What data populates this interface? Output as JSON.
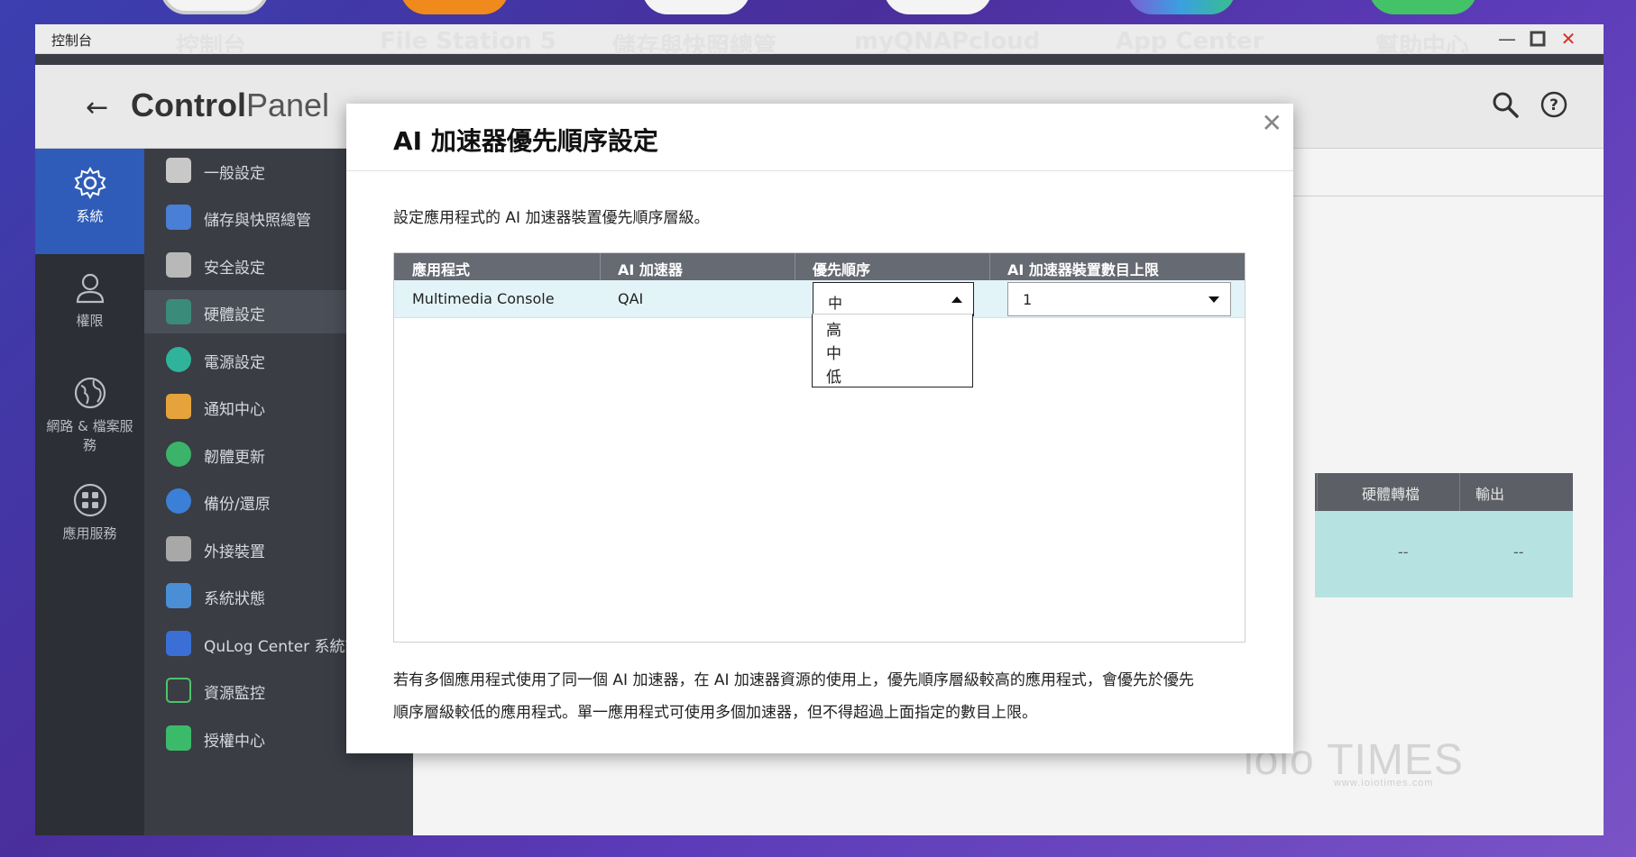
{
  "window": {
    "title": "控制台",
    "taskbar_ghost": [
      "控制台",
      "File Station 5",
      "儲存與快照總管",
      "myQNAPcloud",
      "App Center",
      "幫助中心"
    ]
  },
  "header": {
    "title_bold": "Control",
    "title_light": "Panel"
  },
  "categories": [
    {
      "label": "系統",
      "icon": "gear-icon",
      "active": true
    },
    {
      "label": "權限",
      "icon": "user-icon",
      "active": false
    },
    {
      "label": "網路 & 檔案服務",
      "icon": "globe-icon",
      "active": false
    },
    {
      "label": "應用服務",
      "icon": "apps-grid-icon",
      "active": false
    }
  ],
  "menu": [
    {
      "label": "一般設定",
      "icon": "general-settings-icon",
      "color": "#c8c8c8",
      "active": false
    },
    {
      "label": "儲存與快照總管",
      "icon": "storage-snapshot-icon",
      "color": "#4a7fd6",
      "active": false
    },
    {
      "label": "安全設定",
      "icon": "lock-icon",
      "color": "#b8b8b8",
      "active": false
    },
    {
      "label": "硬體設定",
      "icon": "hardware-chip-icon",
      "color": "#3b8b7a",
      "active": true
    },
    {
      "label": "電源設定",
      "icon": "power-bulb-icon",
      "color": "#2fb39a",
      "active": false
    },
    {
      "label": "通知中心",
      "icon": "notification-bell-icon",
      "color": "#e7a33b",
      "active": false
    },
    {
      "label": "韌體更新",
      "icon": "firmware-update-icon",
      "color": "#3bb36a",
      "active": false
    },
    {
      "label": "備份/還原",
      "icon": "backup-restore-icon",
      "color": "#3b7fd6",
      "active": false
    },
    {
      "label": "外接裝置",
      "icon": "external-device-icon",
      "color": "#a8a8a8",
      "active": false
    },
    {
      "label": "系統狀態",
      "icon": "system-status-icon",
      "color": "#4a8fd6",
      "active": false
    },
    {
      "label": "QuLog Center 系統記",
      "icon": "qulog-icon",
      "color": "#3b6fd6",
      "active": false
    },
    {
      "label": "資源監控",
      "icon": "resource-monitor-icon",
      "color": "#4cc46a",
      "active": false
    },
    {
      "label": "授權中心",
      "icon": "license-center-icon",
      "color": "#3bbb6a",
      "active": false
    }
  ],
  "background_table": {
    "headers": [
      "硬體轉檔",
      "輸出"
    ],
    "cells": [
      "--",
      "--"
    ]
  },
  "modal": {
    "title": "AI 加速器優先順序設定",
    "description": "設定應用程式的 AI 加速器裝置優先順序層級。",
    "columns": [
      "應用程式",
      "AI 加速器",
      "優先順序",
      "AI 加速器裝置數目上限"
    ],
    "rows": [
      {
        "app": "Multimedia Console",
        "accelerator": "QAI",
        "priority": "中",
        "max_devices": "1"
      }
    ],
    "priority_options": [
      "高",
      "中",
      "低"
    ],
    "footer_line1": "若有多個應用程式使用了同一個 AI 加速器，在 AI 加速器資源的使用上，優先順序層級較高的應用程式，會優先於優先",
    "footer_line2": "順序層級較低的應用程式。單一應用程式可使用多個加速器，但不得超過上面指定的數目上限。"
  },
  "watermark": {
    "text": "ioio TIMES",
    "url_text": "www.ioiotimes.com"
  },
  "colors": {
    "active_category": "#2e5cb8",
    "table_header": "#666a72",
    "selected_row": "#e3f4f8",
    "close_button": "#d6312a"
  }
}
